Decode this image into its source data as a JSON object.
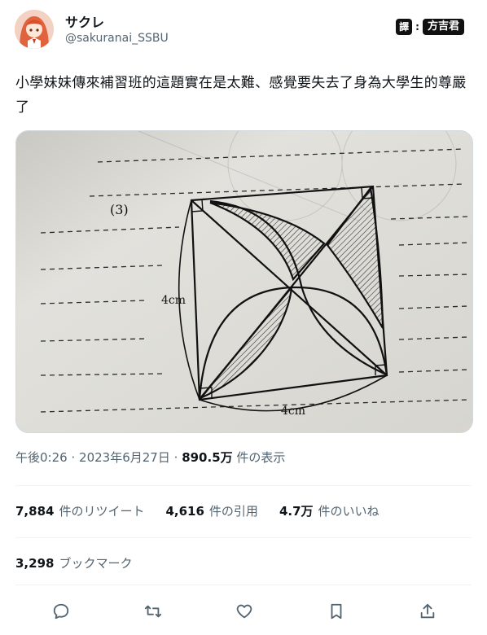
{
  "author": {
    "name": "サクレ",
    "handle": "@sakuranai_SSBU",
    "avatar_icon": "avatar-icon"
  },
  "translator": {
    "badge": "譯",
    "separator": ":",
    "name": "方吉君"
  },
  "post": {
    "text": "小學妹妹傳來補習班的這題實在是太難、感覺要失去了身為大學生的尊嚴了"
  },
  "media": {
    "problem_number": "(3)",
    "side_label_left": "4cm",
    "side_label_bottom": "4cm"
  },
  "meta": {
    "time": "午後0:26",
    "date": "2023年6月27日",
    "separator": "·",
    "views": "890.5万",
    "views_label": "件の表示"
  },
  "stats": {
    "retweets_count": "7,884",
    "retweets_label": "件のリツイート",
    "quotes_count": "4,616",
    "quotes_label": "件の引用",
    "likes_count": "4.7万",
    "likes_label": "件のいいね"
  },
  "bookmarks": {
    "count": "3,298",
    "label": "ブックマーク"
  },
  "actions": [
    "reply-icon",
    "retweet-icon",
    "like-icon",
    "bookmark-icon",
    "share-icon"
  ],
  "colors": {
    "text": "#0f1419",
    "secondary": "#536471",
    "divider": "#eff3f4"
  }
}
